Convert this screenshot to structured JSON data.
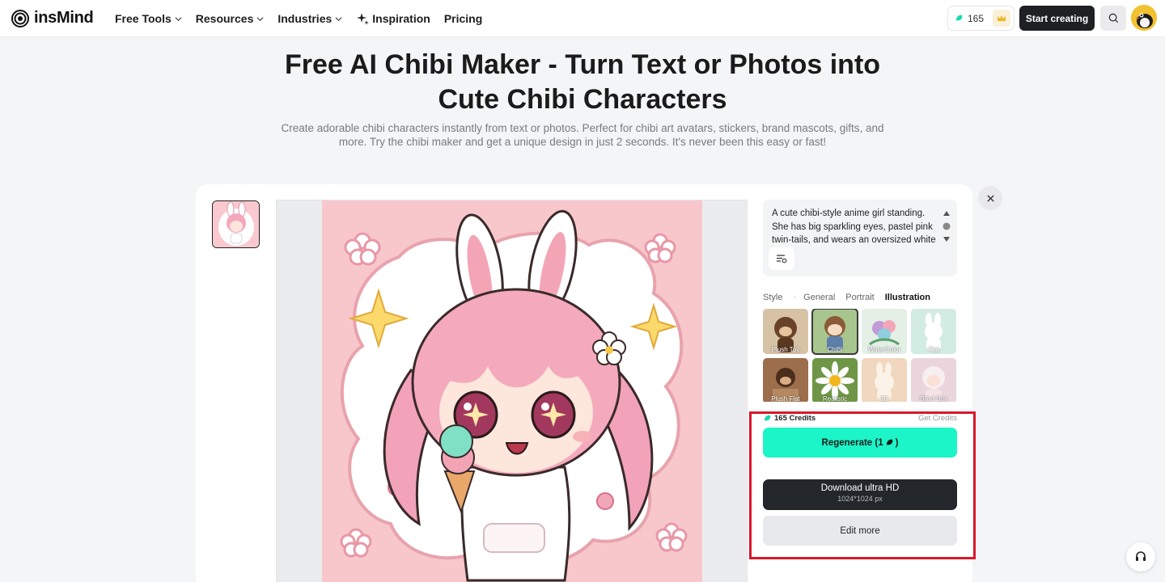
{
  "brand": {
    "name": "insMind"
  },
  "nav": {
    "items": [
      {
        "label": "Free Tools",
        "dropdown": true
      },
      {
        "label": "Resources",
        "dropdown": true
      },
      {
        "label": "Industries",
        "dropdown": true
      },
      {
        "label": "Inspiration",
        "dropdown": false
      },
      {
        "label": "Pricing",
        "dropdown": false
      }
    ],
    "credits": "165",
    "start_label": "Start creating"
  },
  "hero": {
    "title": "Free AI Chibi Maker - Turn Text or Photos into Cute Chibi Characters",
    "subtitle": "Create adorable chibi characters instantly from text or photos. Perfect for chibi art avatars, stickers, brand mascots, gifts, and more. Try the chibi maker and get a unique design in just 2 seconds. It's never been this easy or fast!"
  },
  "editor": {
    "prompt": "A cute chibi-style anime girl standing. She has big sparkling eyes, pastel pink twin-tails, and wears an oversized white hoodie while holding an ice cream cone.",
    "style_tabs": [
      "Style",
      "·",
      "General",
      "Portrait",
      "Illustration"
    ],
    "active_tab": "Illustration",
    "styles": [
      {
        "label": "Plush Toy",
        "color": "#c9a57c"
      },
      {
        "label": "ChiBi",
        "color": "#a9c58e",
        "selected": true
      },
      {
        "label": "WaterColor",
        "color": "#b9dcc2"
      },
      {
        "label": "Flat",
        "color": "#cfe8e0"
      },
      {
        "label": "Plush Flat",
        "color": "#9c6e4c"
      },
      {
        "label": "Realistic",
        "color": "#7ea052"
      },
      {
        "label": "3D",
        "color": "#f0d7bd"
      },
      {
        "label": "Blind Box",
        "color": "#ead5dc"
      }
    ],
    "credits_label": "165 Credits",
    "get_credits": "Get Credits",
    "regenerate_label": "Regenerate (1",
    "regenerate_tail": ")",
    "download_label": "Download ultra HD",
    "download_size": "1024*1024 px",
    "edit_label": "Edit more"
  },
  "colors": {
    "accent": "#1cf5c8",
    "dark": "#23262b",
    "highlight": "#d9182a",
    "art_bg": "#f8c7cb"
  }
}
